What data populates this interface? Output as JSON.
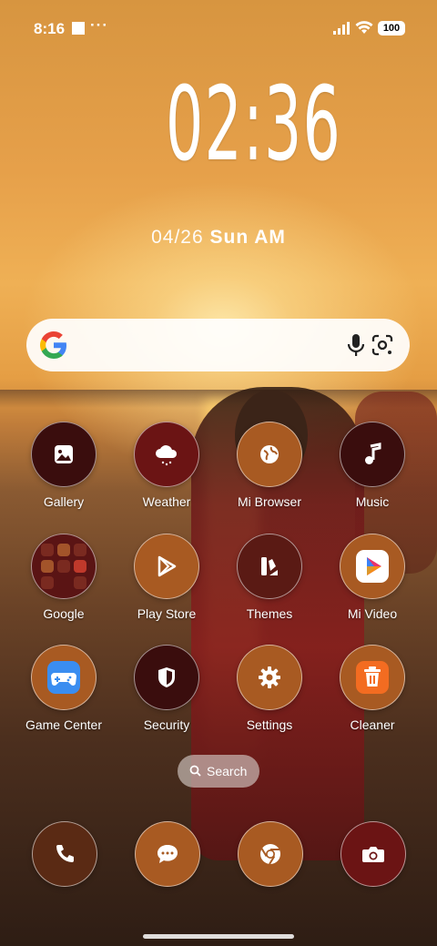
{
  "status_bar": {
    "time": "8:16",
    "extra": "···",
    "battery": "100"
  },
  "clock": {
    "time": "02:36",
    "date": "04/26",
    "weekday": "Sun AM"
  },
  "search_widget": {
    "google_icon": "google-g-logo",
    "mic_icon": "microphone-icon",
    "lens_icon": "google-lens-icon"
  },
  "apps": [
    {
      "label": "Gallery",
      "icon": "gallery-icon",
      "color": "#3a0d0d"
    },
    {
      "label": "Weather",
      "icon": "weather-icon",
      "color": "#6b1414"
    },
    {
      "label": "Mi Browser",
      "icon": "globe-icon",
      "color": "#a85a22"
    },
    {
      "label": "Music",
      "icon": "music-note-icon",
      "color": "#3a0d0d"
    },
    {
      "label": "Google",
      "icon": "folder-icon",
      "color": "#5a1414"
    },
    {
      "label": "Play Store",
      "icon": "play-store-icon",
      "color": "#a85a22"
    },
    {
      "label": "Themes",
      "icon": "themes-icon",
      "color": "#5a1a14"
    },
    {
      "label": "Mi Video",
      "icon": "mi-video-icon",
      "color": "#a85a22"
    },
    {
      "label": "Game Center",
      "icon": "game-controller-icon",
      "color": "#a85a22"
    },
    {
      "label": "Security",
      "icon": "shield-icon",
      "color": "#3a0d0d"
    },
    {
      "label": "Settings",
      "icon": "gear-icon",
      "color": "#a85a22"
    },
    {
      "label": "Cleaner",
      "icon": "trash-icon",
      "color": "#a85a22"
    }
  ],
  "search_pill": {
    "label": "Search"
  },
  "dock": [
    {
      "name": "phone",
      "icon": "phone-icon",
      "color": "#5a2a14"
    },
    {
      "name": "messages",
      "icon": "chat-bubble-icon",
      "color": "#a85a22"
    },
    {
      "name": "chrome",
      "icon": "chrome-icon",
      "color": "#a85a22"
    },
    {
      "name": "camera",
      "icon": "camera-icon",
      "color": "#6b1414"
    }
  ]
}
